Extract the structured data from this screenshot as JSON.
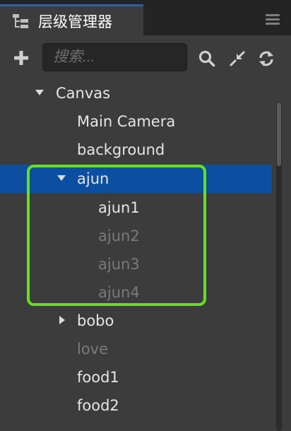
{
  "panel": {
    "tab_title": "层级管理器",
    "tab_icon": "hierarchy-icon",
    "menu_icon": "hamburger-menu-icon"
  },
  "toolbar": {
    "add_icon": "plus-icon",
    "search_placeholder": "搜索...",
    "search_value": "",
    "search_icon": "search-icon",
    "collapse_icon": "collapse-arrows-icon",
    "refresh_icon": "refresh-icon"
  },
  "tree": {
    "nodes": [
      {
        "label": "Canvas",
        "expanded": true,
        "active": true
      },
      {
        "label": "Main Camera",
        "active": true
      },
      {
        "label": "background",
        "active": true
      },
      {
        "label": "ajun",
        "expanded": true,
        "selected": true,
        "active": true
      },
      {
        "label": "ajun1",
        "active": true
      },
      {
        "label": "ajun2",
        "active": false
      },
      {
        "label": "ajun3",
        "active": false
      },
      {
        "label": "ajun4",
        "active": false
      },
      {
        "label": "bobo",
        "expanded": false,
        "active": true
      },
      {
        "label": "love",
        "active": false
      },
      {
        "label": "food1",
        "active": true
      },
      {
        "label": "food2",
        "active": true
      }
    ]
  },
  "colors": {
    "panel_bg": "#3c3c3c",
    "selection": "#0c4fa0",
    "highlight_border": "#62e21f",
    "active_text": "#e6e6e6",
    "inactive_text": "#7a7a7a"
  }
}
